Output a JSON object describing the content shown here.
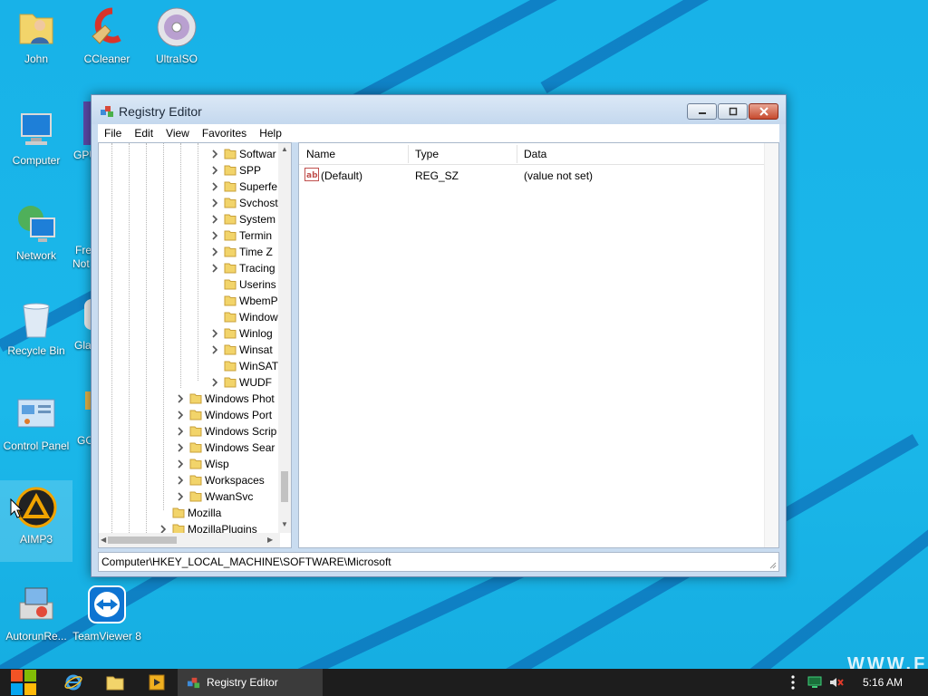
{
  "colors": {
    "desktop_bg": "#1ab4e6",
    "taskbar_bg": "#1d1d1d",
    "folder": "#f2d46a"
  },
  "desktop": {
    "icons": [
      {
        "label": "John",
        "icon": "user-folder-icon"
      },
      {
        "label": "CCleaner",
        "icon": "ccleaner-icon"
      },
      {
        "label": "UltraISO",
        "icon": "disc-icon"
      },
      {
        "label": "Computer",
        "icon": "computer-icon"
      },
      {
        "label": "Network",
        "icon": "network-icon"
      },
      {
        "label": "Recycle Bin",
        "icon": "recycle-bin-icon"
      },
      {
        "label": "Control Panel",
        "icon": "control-panel-icon"
      },
      {
        "label": "AIMP3",
        "icon": "aimp-icon"
      },
      {
        "label": "AutorunRe...",
        "icon": "autorun-icon"
      },
      {
        "label": "TeamViewer 8",
        "icon": "teamviewer-icon"
      }
    ],
    "partial_labels": [
      "GPU",
      "Fre",
      "Not",
      "Gla",
      "GC"
    ],
    "watermark": "WWW.FR"
  },
  "window": {
    "title": "Registry Editor",
    "menu": [
      "File",
      "Edit",
      "View",
      "Favorites",
      "Help"
    ],
    "tree": [
      {
        "label": "Softwar",
        "expandable": true
      },
      {
        "label": "SPP",
        "expandable": true
      },
      {
        "label": "Superfe",
        "expandable": true
      },
      {
        "label": "Svchost",
        "expandable": true
      },
      {
        "label": "System",
        "expandable": true
      },
      {
        "label": "Termin",
        "expandable": true
      },
      {
        "label": "Time Z",
        "expandable": true
      },
      {
        "label": "Tracing",
        "expandable": true
      },
      {
        "label": "Userins",
        "expandable": false
      },
      {
        "label": "WbemP",
        "expandable": false
      },
      {
        "label": "Window",
        "expandable": false
      },
      {
        "label": "Winlog",
        "expandable": true
      },
      {
        "label": "Winsat",
        "expandable": true
      },
      {
        "label": "WinSAT",
        "expandable": false
      },
      {
        "label": "WUDF",
        "expandable": true
      },
      {
        "label": "Windows Phot",
        "expandable": true
      },
      {
        "label": "Windows Port",
        "expandable": true
      },
      {
        "label": "Windows Scrip",
        "expandable": true
      },
      {
        "label": "Windows Sear",
        "expandable": true
      },
      {
        "label": "Wisp",
        "expandable": true
      },
      {
        "label": "Workspaces",
        "expandable": true
      },
      {
        "label": "WwanSvc",
        "expandable": true
      },
      {
        "label": "Mozilla",
        "expandable": false
      },
      {
        "label": "MozillaPlugins",
        "expandable": true
      }
    ],
    "columns": {
      "name": "Name",
      "type": "Type",
      "data": "Data"
    },
    "values": [
      {
        "name": "(Default)",
        "type": "REG_SZ",
        "data": "(value not set)"
      }
    ],
    "status_path": "Computer\\HKEY_LOCAL_MACHINE\\SOFTWARE\\Microsoft"
  },
  "taskbar": {
    "active_label": "Registry Editor",
    "clock": "5:16 AM"
  }
}
